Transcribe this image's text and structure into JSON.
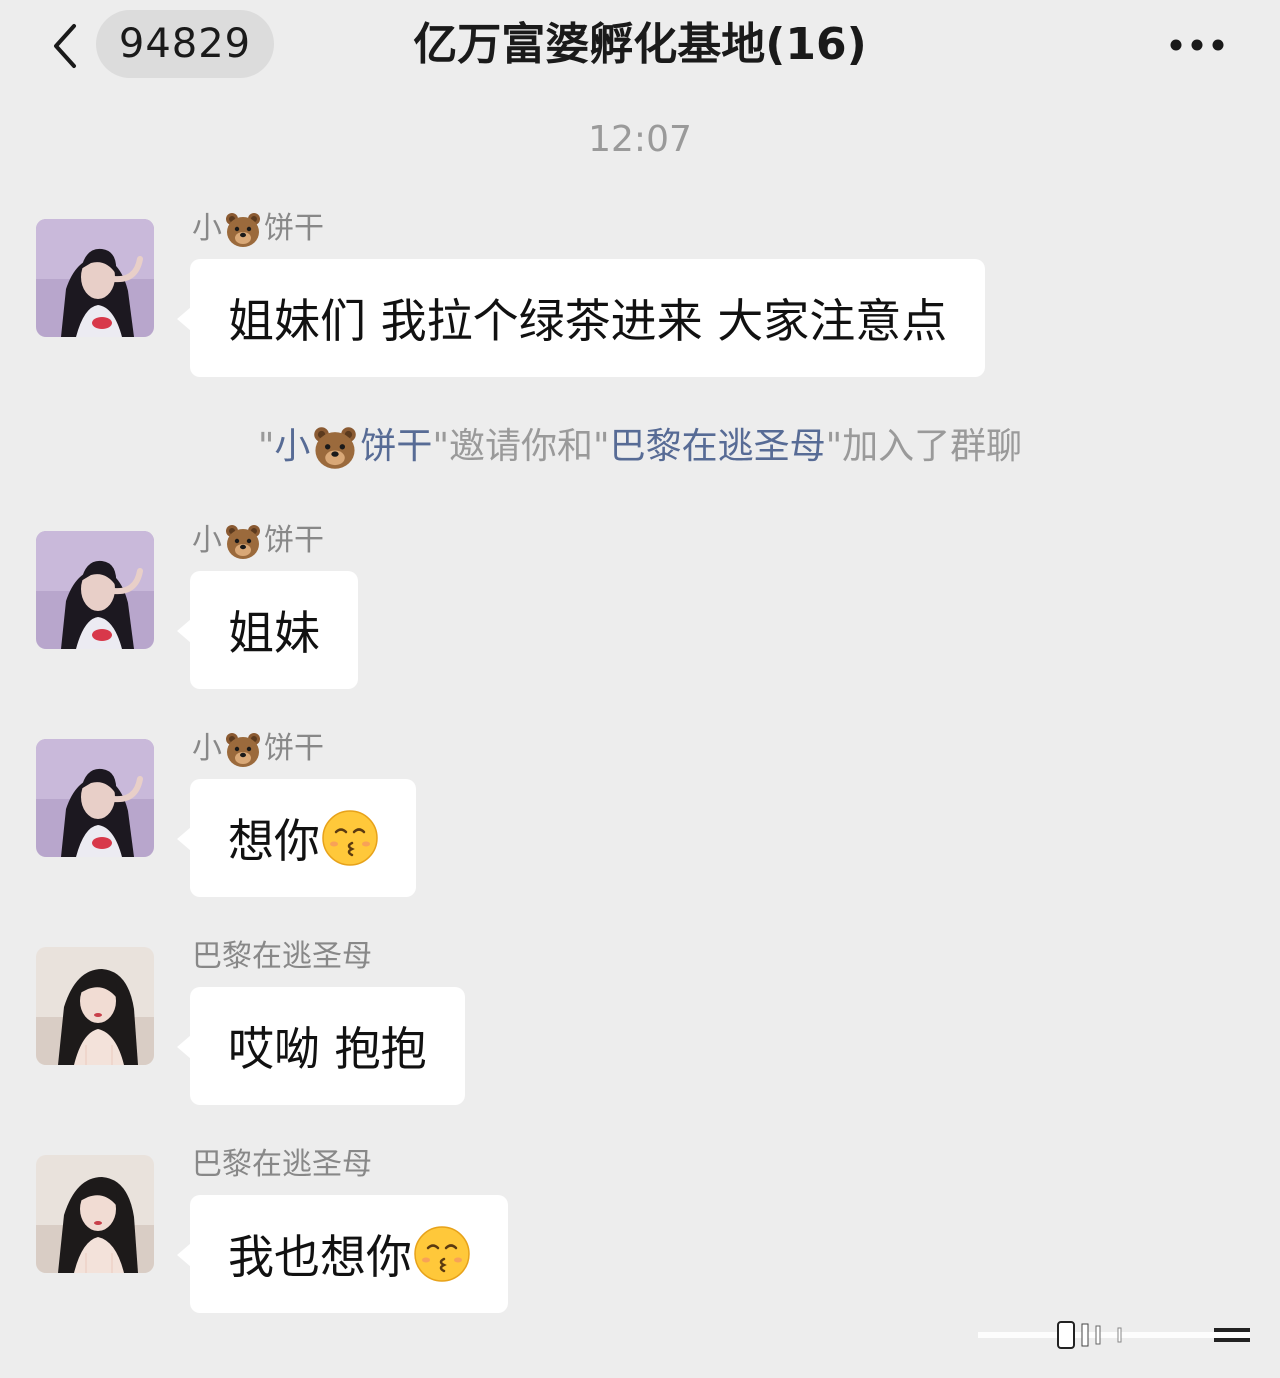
{
  "header": {
    "unread_count": "94829",
    "title": "亿万富婆孵化基地(16)",
    "back_icon": "chevron-left-icon",
    "more_icon": "more-dots-icon"
  },
  "time_label": "12:07",
  "messages": [
    {
      "sender_prefix": "小",
      "sender_suffix": "饼干",
      "sender_emoji": "bear-face",
      "text": "姐妹们 我拉个绿茶进来 大家注意点"
    },
    {
      "sender_prefix": "小",
      "sender_suffix": "饼干",
      "sender_emoji": "bear-face",
      "text": "姐妹"
    },
    {
      "sender_prefix": "小",
      "sender_suffix": "饼干",
      "sender_emoji": "bear-face",
      "text": "想你",
      "trailing_emoji": "kissing-face"
    },
    {
      "sender": "巴黎在逃圣母",
      "text": "哎呦 抱抱"
    },
    {
      "sender": "巴黎在逃圣母",
      "text": "我也想你",
      "trailing_emoji": "kissing-face"
    }
  ],
  "system_notice": {
    "quote_open": "\"",
    "inviter_prefix": "小",
    "inviter_suffix": "饼干",
    "middle": "\"邀请你和\"",
    "invitee": "巴黎在逃圣母",
    "end": "\"加入了群聊"
  },
  "colors": {
    "background": "#ededed",
    "bubble": "#ffffff",
    "link": "#576b95",
    "muted": "#9a9a9a"
  }
}
